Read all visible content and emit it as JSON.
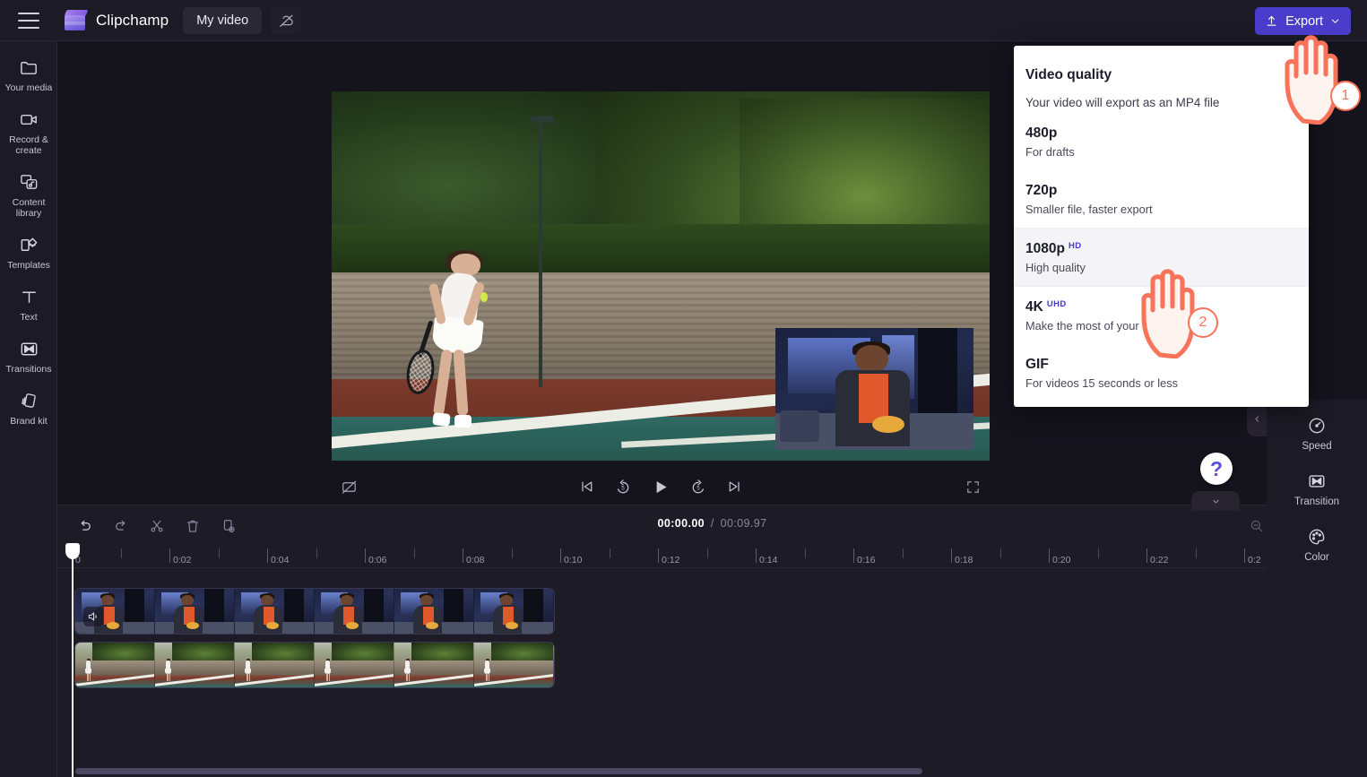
{
  "app": {
    "brand_name": "Clipchamp",
    "project_tab": "My video",
    "menu_icon": "hamburger-icon",
    "cloud_icon": "cloud-off-icon",
    "logo_icon": "clipchamp-logo-icon"
  },
  "topbar": {
    "export_label": "Export",
    "export_icon": "upload-icon",
    "export_chevron": "chevron-down-icon",
    "export_color": "#4b3dcb"
  },
  "sidebar": {
    "items": [
      {
        "label": "Your media",
        "icon": "folder-icon"
      },
      {
        "label": "Record & create",
        "icon": "video-camera-icon"
      },
      {
        "label": "Content library",
        "icon": "content-library-icon"
      },
      {
        "label": "Templates",
        "icon": "templates-icon"
      },
      {
        "label": "Text",
        "icon": "text-icon"
      },
      {
        "label": "Transitions",
        "icon": "transitions-icon"
      },
      {
        "label": "Brand kit",
        "icon": "brand-kit-icon"
      }
    ],
    "expand_icon": "chevron-right-icon"
  },
  "export_menu": {
    "title": "Video quality",
    "subtitle": "Your video will export as an MP4 file",
    "options": [
      {
        "title": "480p",
        "badge": "",
        "desc": "For drafts",
        "active": false
      },
      {
        "title": "720p",
        "badge": "",
        "desc": "Smaller file, faster export",
        "active": false
      },
      {
        "title": "1080p",
        "badge": "HD",
        "desc": "High quality",
        "active": true
      },
      {
        "title": "4K",
        "badge": "UHD",
        "desc": "Make the most of your 4K f",
        "active": false
      },
      {
        "title": "GIF",
        "badge": "",
        "desc": "For videos 15 seconds or less",
        "active": false
      }
    ],
    "badge_color": "#4338d4"
  },
  "preview": {
    "controls": [
      {
        "name": "captions-off-icon"
      },
      {
        "name": "skip-previous-icon"
      },
      {
        "name": "rewind-5-icon"
      },
      {
        "name": "play-icon"
      },
      {
        "name": "forward-5-icon"
      },
      {
        "name": "skip-next-icon"
      },
      {
        "name": "fullscreen-icon"
      }
    ],
    "help_glyph": "?"
  },
  "properties_panel": {
    "items": [
      {
        "label": "Speed",
        "icon": "speedometer-icon"
      },
      {
        "label": "Transition",
        "icon": "transition-icon"
      },
      {
        "label": "Color",
        "icon": "palette-icon"
      }
    ]
  },
  "timeline": {
    "tools": [
      {
        "name": "undo-icon"
      },
      {
        "name": "redo-icon"
      },
      {
        "name": "split-scissors-icon"
      },
      {
        "name": "delete-trash-icon"
      },
      {
        "name": "duplicate-icon"
      }
    ],
    "current_time": "00:00.00",
    "separator": "/",
    "total_time": "00:09.97",
    "zoom_controls": [
      {
        "name": "zoom-out-icon"
      },
      {
        "name": "zoom-in-icon"
      },
      {
        "name": "fit-to-screen-icon"
      }
    ],
    "ruler_labels": [
      "0",
      "0:02",
      "0:04",
      "0:06",
      "0:08",
      "0:10",
      "0:12",
      "0:14",
      "0:16",
      "0:18",
      "0:20",
      "0:22",
      "0:2"
    ],
    "clips": [
      {
        "track": "video-track-1",
        "audio_icon": "speaker-icon",
        "thumbnails": 6
      },
      {
        "track": "video-track-2",
        "audio_icon": "",
        "thumbnails": 6
      }
    ]
  },
  "callouts": [
    {
      "number": "1"
    },
    {
      "number": "2"
    }
  ]
}
